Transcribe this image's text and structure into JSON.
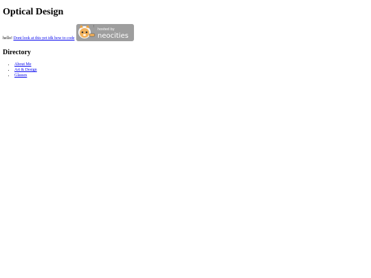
{
  "page": {
    "title": "Optical Design",
    "intro_text": "hello! ",
    "intro_link": "Dont look at this yet idk how to code",
    "badge": {
      "hosted_by": "hosted by",
      "brand": "neocities",
      "bg_color": "#9e9e9e"
    }
  },
  "directory": {
    "heading": "Directory",
    "items": [
      {
        "label": "About Me"
      },
      {
        "label": "Art & Design"
      },
      {
        "label": "Glasses"
      }
    ]
  },
  "colors": {
    "link": "#0000ee",
    "text": "#000000",
    "background": "#ffffff"
  }
}
